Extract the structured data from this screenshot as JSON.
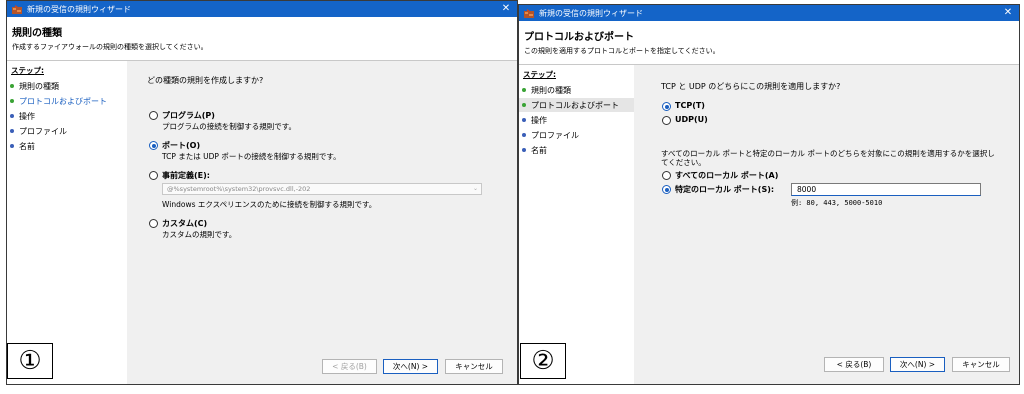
{
  "window1": {
    "title": "新規の受信の規則ウィザード",
    "header_title": "規則の種類",
    "header_subtitle": "作成するファイアウォールの規則の種類を選択してください。",
    "steps_heading": "ステップ:",
    "steps": [
      "規則の種類",
      "プロトコルおよびポート",
      "操作",
      "プロファイル",
      "名前"
    ],
    "question": "どの種類の規則を作成しますか?",
    "options": [
      {
        "label": "プログラム(P)",
        "desc": "プログラムの接続を制御する規則です。",
        "checked": false
      },
      {
        "label": "ポート(O)",
        "desc": "TCP または UDP ポートの接続を制御する規則です。",
        "checked": true
      },
      {
        "label": "事前定義(E):",
        "desc": "Windows エクスペリエンスのために接続を制御する規則です。",
        "checked": false
      },
      {
        "label": "カスタム(C)",
        "desc": "カスタムの規則です。",
        "checked": false
      }
    ],
    "predefined_value": "@%systemroot%\\system32\\provsvc.dll,-202",
    "buttons": {
      "back": "< 戻る(B)",
      "next": "次へ(N) >",
      "cancel": "キャンセル"
    }
  },
  "window2": {
    "title": "新規の受信の規則ウィザード",
    "header_title": "プロトコルおよびポート",
    "header_subtitle": "この規則を適用するプロトコルとポートを指定してください。",
    "steps_heading": "ステップ:",
    "steps": [
      "規則の種類",
      "プロトコルおよびポート",
      "操作",
      "プロファイル",
      "名前"
    ],
    "question_protocol": "TCP と UDP のどちらにこの規則を適用しますか?",
    "protocols": [
      {
        "label": "TCP(T)",
        "checked": true
      },
      {
        "label": "UDP(U)",
        "checked": false
      }
    ],
    "question_ports_line1": "すべてのローカル ポートと特定のローカル ポートのどちらを対象にこの規則を適用するかを選択し",
    "question_ports_line2": "てください。",
    "port_options": [
      {
        "label": "すべてのローカル ポート(A)",
        "checked": false
      },
      {
        "label": "特定のローカル ポート(S):",
        "checked": true
      }
    ],
    "port_value": "8000",
    "port_hint": "例: 80, 443, 5000-5010",
    "buttons": {
      "back": "< 戻る(B)",
      "next": "次へ(N) >",
      "cancel": "キャンセル"
    }
  },
  "labels": {
    "one": "①",
    "two": "②"
  },
  "colors": {
    "titlebar": "#1464c8",
    "accent": "#1a5fc0",
    "step_done": "#3aa335",
    "step_todo": "#3b5fb8"
  },
  "icons": {
    "app": "firewall-icon",
    "close": "close-icon"
  }
}
